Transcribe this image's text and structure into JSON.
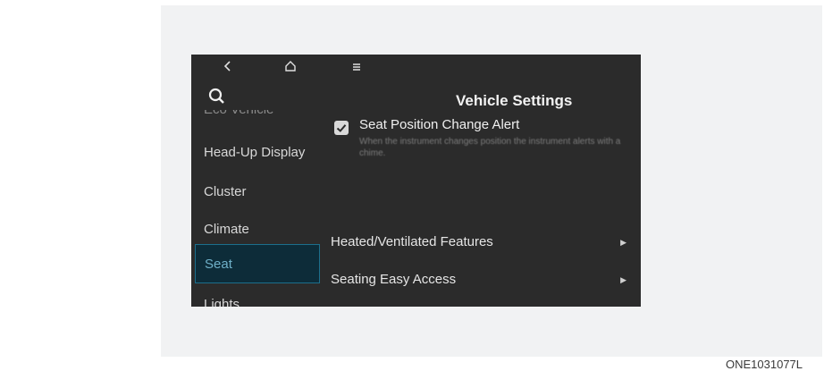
{
  "nav": {
    "back_icon": "chevron-left-icon",
    "home_icon": "home-icon",
    "menu_icon": "menu-icon",
    "search_icon": "search-icon"
  },
  "header": {
    "title": "Vehicle Settings"
  },
  "sidebar": {
    "items": [
      {
        "label": "Eco Vehicle",
        "selected": false
      },
      {
        "label": "Head-Up Display",
        "selected": false
      },
      {
        "label": "Cluster",
        "selected": false
      },
      {
        "label": "Climate",
        "selected": false
      },
      {
        "label": "Seat",
        "selected": true
      },
      {
        "label": "Lights",
        "selected": false
      }
    ]
  },
  "content": {
    "seat_alert": {
      "label": "Seat Position Change Alert",
      "checked": true,
      "description": "When the instrument changes position the instrument alerts with a chime."
    },
    "rows": [
      {
        "label": "Heated/Ventilated Features",
        "icon": "triangle-right-icon"
      },
      {
        "label": "Seating Easy Access",
        "icon": "triangle-right-icon"
      }
    ]
  },
  "caption": "ONE1031077L",
  "colors": {
    "screen_bg": "#2b2b2b",
    "selected_border": "#1c6f8c",
    "selected_bg": "#0d2c39"
  }
}
